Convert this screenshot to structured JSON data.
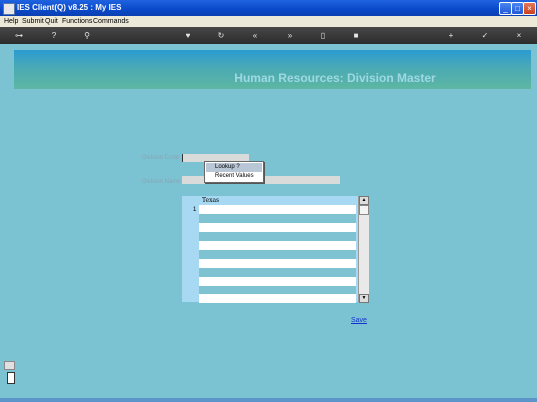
{
  "window": {
    "title": "IES Client(Q) v8.25 : My IES",
    "minimize_glyph": "_",
    "maximize_glyph": "□",
    "close_glyph": "×"
  },
  "menu": {
    "items": [
      "Help",
      "Submit",
      "Quit",
      "Functions",
      "Commands"
    ]
  },
  "toolbar": {
    "icons": [
      {
        "name": "key-icon",
        "glyph": "⊶"
      },
      {
        "name": "help-icon",
        "glyph": "?"
      },
      {
        "name": "search-icon",
        "glyph": "⚲"
      },
      {
        "name": "heart-icon",
        "glyph": "♥"
      },
      {
        "name": "refresh-icon",
        "glyph": "↻"
      },
      {
        "name": "rewind-icon",
        "glyph": "«"
      },
      {
        "name": "forward-icon",
        "glyph": "»"
      },
      {
        "name": "document-icon",
        "glyph": "▯"
      },
      {
        "name": "stop-icon",
        "glyph": "■"
      },
      {
        "name": "add-icon",
        "glyph": "+"
      },
      {
        "name": "check-icon",
        "glyph": "✓"
      },
      {
        "name": "close-icon",
        "glyph": "×"
      }
    ]
  },
  "page": {
    "title": "Human Resources: Division Master",
    "division_code_label": "Division Code",
    "division_code_value": "",
    "division_name_label": "Division Name",
    "division_name_value": ""
  },
  "popup_menu": {
    "items": [
      "Lookup ?",
      "Recent Values"
    ],
    "highlighted": "Lookup ?"
  },
  "grid": {
    "header": "Texas",
    "row_numbers": [
      "1"
    ]
  },
  "actions": {
    "save_label": "Save"
  },
  "colors": {
    "background": "#7bc3d3",
    "titlebar": "#0a49c9",
    "link": "#1433cc"
  }
}
